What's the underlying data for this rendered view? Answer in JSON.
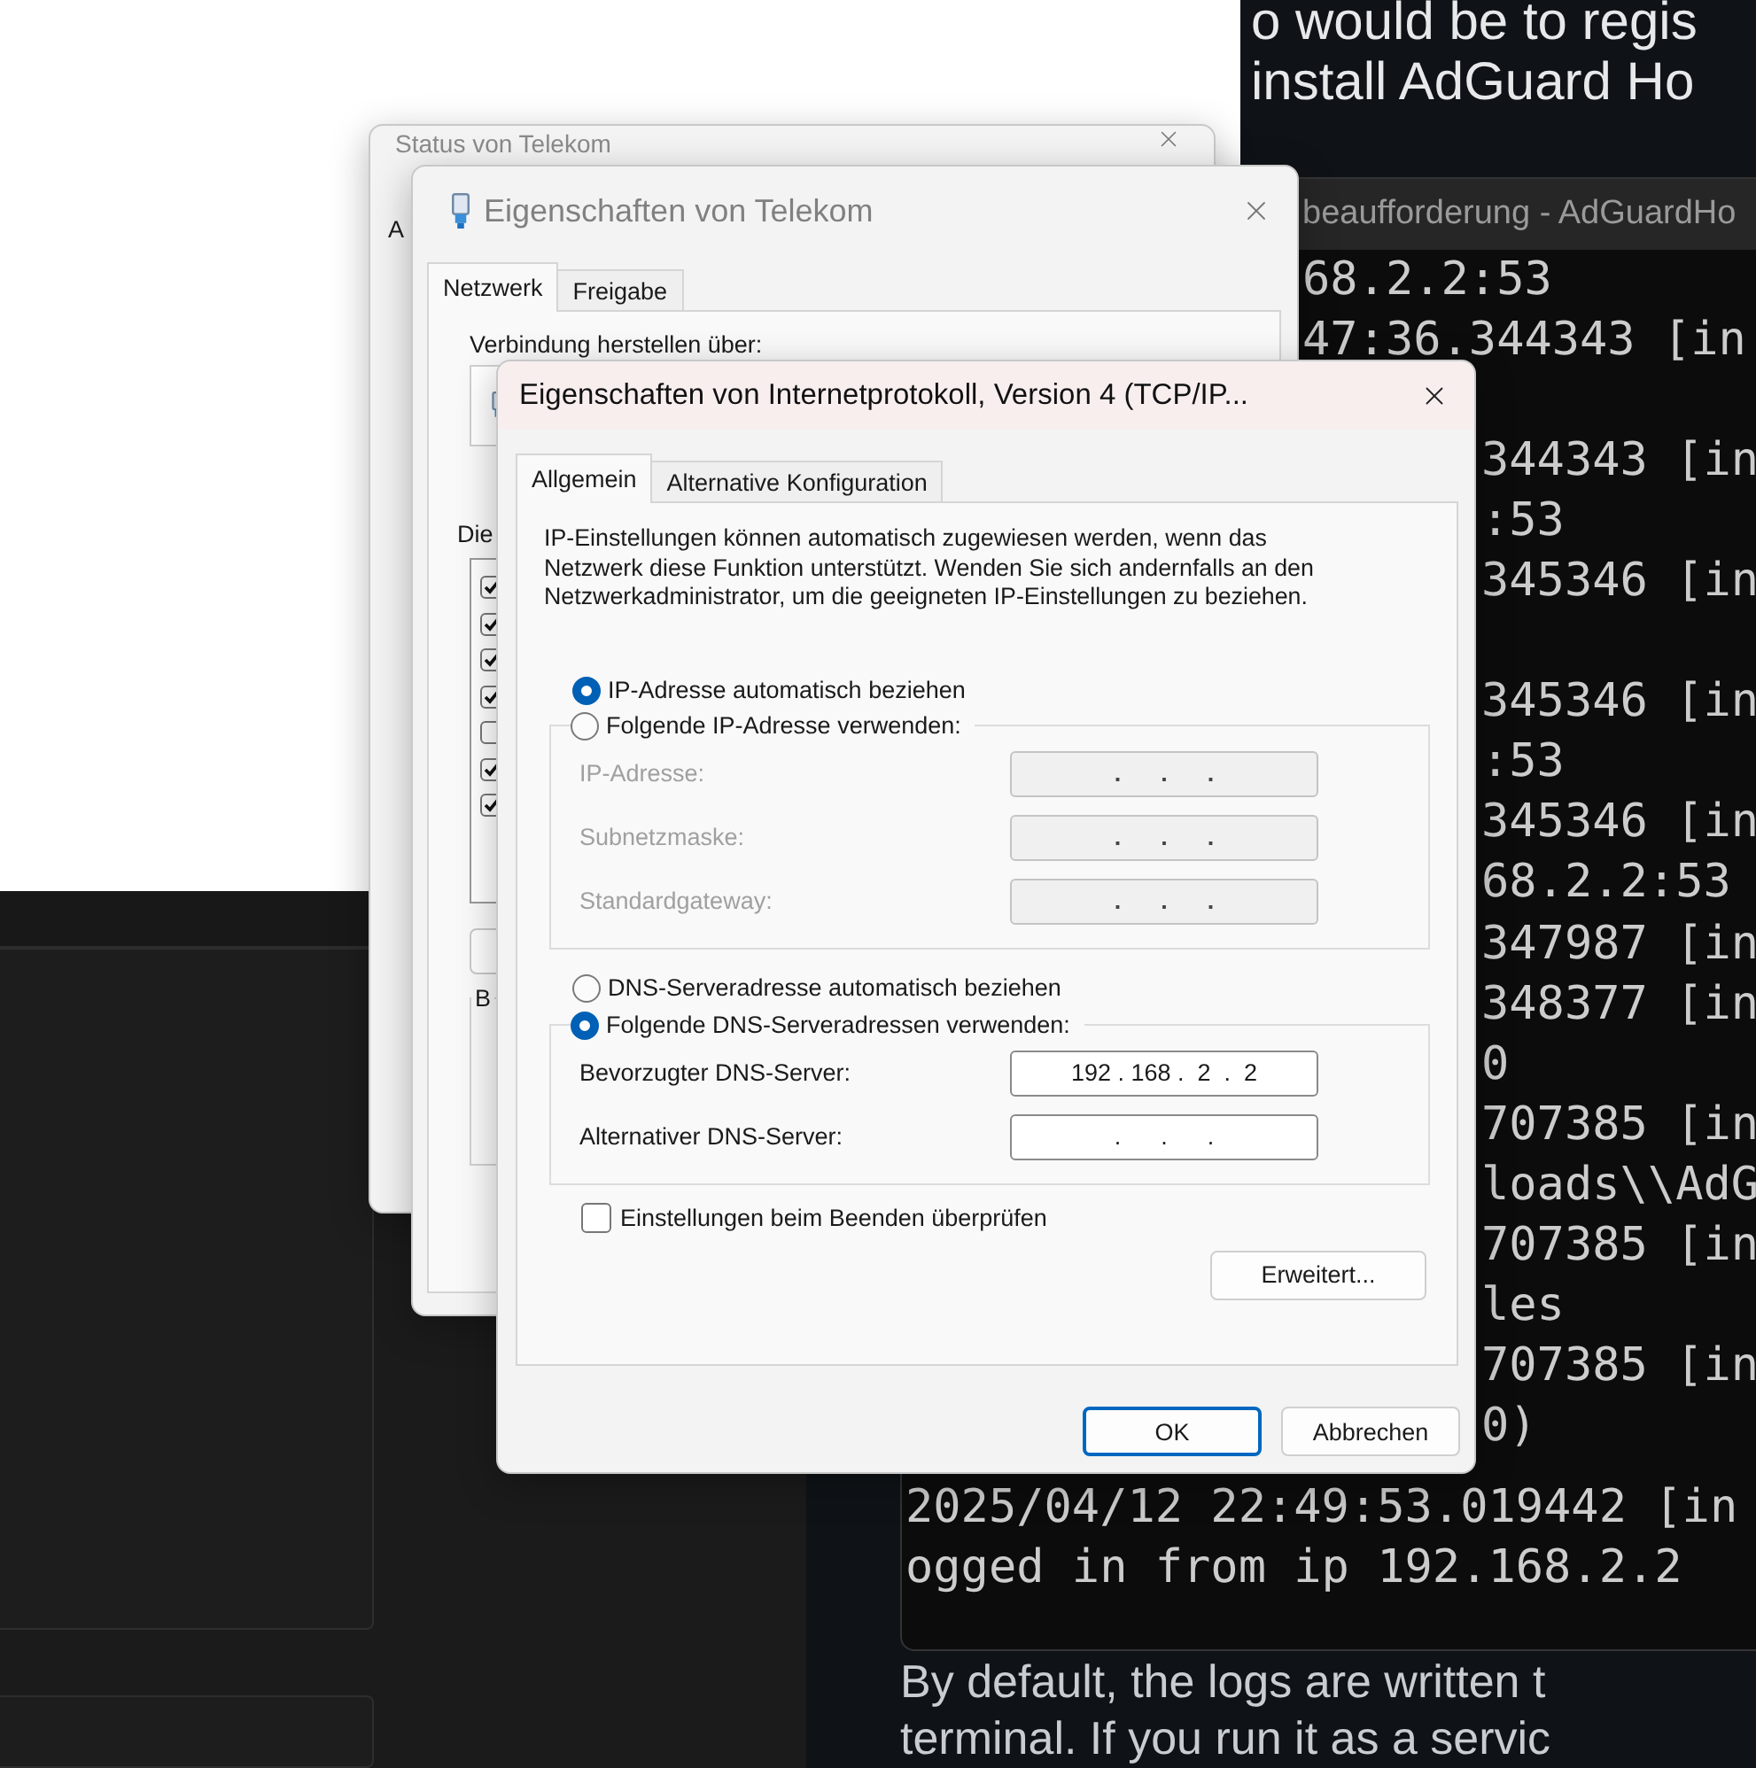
{
  "article": {
    "top_lines": [
      "o would be to regis",
      "install AdGuard Ho"
    ],
    "bottom_lines": [
      "By default, the logs are written t",
      "terminal. If you run it as a servic"
    ]
  },
  "terminal": {
    "title": "beaufforderung - AdGuardHo",
    "lines": [
      "68.2.2:53",
      "47:36.344343 [in",
      "344343 [in",
      ":53",
      "345346 [in",
      "345346 [in",
      ":53",
      "345346 [in",
      "68.2.2:53",
      "347987 [in",
      "348377 [in",
      "0",
      "707385 [in",
      "loads\\\\AdG",
      "707385 [in",
      "les",
      "707385 [in",
      "0)",
      "2025/04/12 22:49:53.019442 [in",
      "ogged in from ip 192.168.2.2"
    ]
  },
  "status_dialog": {
    "title": "Status von Telekom",
    "tab": "A"
  },
  "properties_dialog": {
    "title": "Eigenschaften von Telekom",
    "tabs": [
      {
        "label": "Netzwerk",
        "selected": true
      },
      {
        "label": "Freigabe",
        "selected": false
      }
    ],
    "connect_label": "Verbindung herstellen über:",
    "components_label": "Die",
    "components": [
      {
        "checked": true
      },
      {
        "checked": true
      },
      {
        "checked": true
      },
      {
        "checked": true
      },
      {
        "checked": false
      },
      {
        "checked": true
      },
      {
        "checked": true
      }
    ],
    "description_label": "B"
  },
  "ipv4_dialog": {
    "title": "Eigenschaften von Internetprotokoll, Version 4 (TCP/IP...",
    "tabs": [
      {
        "label": "Allgemein",
        "selected": true
      },
      {
        "label": "Alternative Konfiguration",
        "selected": false
      }
    ],
    "description": "IP-Einstellungen können automatisch zugewiesen werden, wenn das Netzwerk diese Funktion unterstützt. Wenden Sie sich andernfalls an den Netzwerkadministrator, um die geeigneten IP-Einstellungen zu beziehen.",
    "ip_auto": {
      "label": "IP-Adresse automatisch beziehen",
      "selected": true
    },
    "ip_manual": {
      "label": "Folgende IP-Adresse verwenden:",
      "selected": false,
      "fields": [
        {
          "label": "IP-Adresse:",
          "value": ".      .      .",
          "disabled": true
        },
        {
          "label": "Subnetzmaske:",
          "value": ".      .      .",
          "disabled": true
        },
        {
          "label": "Standardgateway:",
          "value": ".      .      .",
          "disabled": true
        }
      ]
    },
    "dns_auto": {
      "label": "DNS-Serveradresse automatisch beziehen",
      "selected": false
    },
    "dns_manual": {
      "label": "Folgende DNS-Serveradressen verwenden:",
      "selected": true,
      "fields": [
        {
          "label": "Bevorzugter DNS-Server:",
          "value": "192 . 168 .  2  .  2",
          "disabled": false
        },
        {
          "label": "Alternativer DNS-Server:",
          "value": ".      .      .",
          "disabled": false
        }
      ]
    },
    "validate": {
      "label": "Einstellungen beim Beenden überprüfen",
      "checked": false
    },
    "advanced_button": "Erweitert...",
    "buttons": [
      {
        "label": "OK",
        "default": true
      },
      {
        "label": "Abbrechen",
        "default": false
      }
    ]
  }
}
